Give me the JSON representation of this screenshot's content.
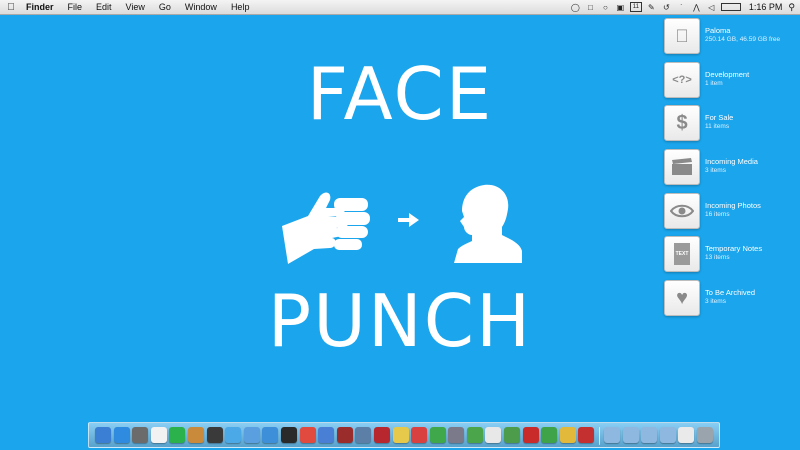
{
  "menubar": {
    "apple_icon": "apple-logo-icon",
    "app_name": "Finder",
    "menus": [
      "File",
      "Edit",
      "View",
      "Go",
      "Window",
      "Help"
    ],
    "status_icons": [
      "dropbox-icon",
      "gmail-icon",
      "evernote-icon",
      "display-icon",
      "calendar-icon",
      "notes-icon",
      "time-machine-icon",
      "bluetooth-icon",
      "wifi-icon",
      "volume-icon",
      "battery-icon"
    ],
    "calendar_badge": "11",
    "clock": "1:16 PM",
    "spotlight_icon": "spotlight-icon"
  },
  "wallpaper": {
    "line1": "FACE",
    "line2": "PUNCH",
    "glyphs": [
      "fist-icon",
      "arrow-icon",
      "head-icon"
    ]
  },
  "desktop_items": [
    {
      "name": "Paloma",
      "info": "250.14 GB, 46.59 GB free",
      "icon": "apple-drive-icon",
      "glyph": ""
    },
    {
      "name": "Development",
      "info": "1 item",
      "icon": "code-folder-icon",
      "glyph": "<?>"
    },
    {
      "name": "For Sale",
      "info": "11 items",
      "icon": "dollar-folder-icon",
      "glyph": "$"
    },
    {
      "name": "Incoming Media",
      "info": "3 items",
      "icon": "clapperboard-folder-icon",
      "glyph": ""
    },
    {
      "name": "Incoming Photos",
      "info": "16 items",
      "icon": "eye-folder-icon",
      "glyph": ""
    },
    {
      "name": "Temporary Notes",
      "info": "13 items",
      "icon": "text-folder-icon",
      "glyph": "TEXT"
    },
    {
      "name": "To Be Archived",
      "info": "3 items",
      "icon": "heart-folder-icon",
      "glyph": ""
    }
  ],
  "dock": {
    "apps": [
      {
        "name": "finder-icon",
        "color": "#3b7fd4"
      },
      {
        "name": "safari-icon",
        "color": "#2f8be0"
      },
      {
        "name": "photos-icon",
        "color": "#6b6b6b"
      },
      {
        "name": "calendar-icon",
        "color": "#f2f2f2"
      },
      {
        "name": "downloads-icon",
        "color": "#2bb24c"
      },
      {
        "name": "package-icon",
        "color": "#c98a3c"
      },
      {
        "name": "facetime-icon",
        "color": "#3a3a3a"
      },
      {
        "name": "twitter-icon",
        "color": "#4aa9e6"
      },
      {
        "name": "mail-icon",
        "color": "#5aa0e0"
      },
      {
        "name": "video-icon",
        "color": "#3c8fd8"
      },
      {
        "name": "terminal-icon",
        "color": "#2a2a2a"
      },
      {
        "name": "chrome-icon",
        "color": "#e04a3f"
      },
      {
        "name": "itunes-icon",
        "color": "#4a7fd6"
      },
      {
        "name": "photo-booth-icon",
        "color": "#9b2c2c"
      },
      {
        "name": "preview-icon",
        "color": "#5b7fa6"
      },
      {
        "name": "acrobat-icon",
        "color": "#b8272e"
      },
      {
        "name": "stickies-icon",
        "color": "#e6c94a"
      },
      {
        "name": "notes-icon",
        "color": "#d94040"
      },
      {
        "name": "leaf-icon",
        "color": "#3ea84a"
      },
      {
        "name": "preferences-icon",
        "color": "#7a7a8a"
      },
      {
        "name": "numbers-icon",
        "color": "#4ba64b"
      },
      {
        "name": "textedit-icon",
        "color": "#e8e8e8"
      },
      {
        "name": "maps-icon",
        "color": "#4c9c4c"
      },
      {
        "name": "books-icon",
        "color": "#c92b2b"
      },
      {
        "name": "stack-icon",
        "color": "#3fa34a"
      },
      {
        "name": "construction-icon",
        "color": "#e2b93b"
      },
      {
        "name": "photobooth-icon",
        "color": "#c43030"
      }
    ],
    "stacks": [
      {
        "name": "applications-folder-icon",
        "color": "#8fb8e0"
      },
      {
        "name": "documents-folder-icon",
        "color": "#8fb8e0"
      },
      {
        "name": "downloads-folder-icon",
        "color": "#8fb8e0"
      },
      {
        "name": "folder-icon",
        "color": "#8fb8e0"
      },
      {
        "name": "textedit-stack-icon",
        "color": "#eaeaea"
      },
      {
        "name": "trash-icon",
        "color": "#9aa4ad"
      }
    ]
  }
}
